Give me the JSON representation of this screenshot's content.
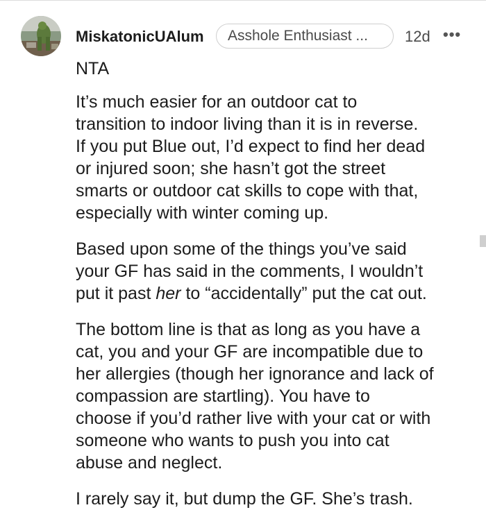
{
  "comment": {
    "username": "MiskatonicUAlum",
    "flair": "Asshole Enthusiast ...",
    "age": "12d",
    "more_label": "•••",
    "paragraphs": [
      {
        "lines": [
          "NTA"
        ]
      },
      {
        "lines": [
          "It’s much easier for an outdoor cat to",
          "transition to indoor living than it is in reverse.",
          "If you put Blue out, I’d expect to find her dead",
          "or injured soon; she hasn’t got the street",
          "smarts or outdoor cat skills to cope with that,",
          "especially with winter coming up."
        ]
      },
      {
        "lines": [
          "Based upon some of the things you’ve said",
          "your GF has said in the comments, I wouldn’t"
        ],
        "last_line": {
          "before": "put it past ",
          "emphasis": "her",
          "after": " to “accidentally” put the cat out."
        }
      },
      {
        "lines": [
          "The bottom line is that as long as you have a",
          "cat, you and your GF are incompatible due to",
          "her allergies (though her ignorance and lack of",
          "compassion are startling). You have to",
          "choose if you’d rather live with your cat or with",
          "someone who wants to push you into cat",
          "abuse and neglect."
        ]
      },
      {
        "lines": [
          "I rarely say it, but dump the GF. She’s trash."
        ]
      }
    ]
  },
  "icons": {
    "avatar": "avatar-image",
    "more": "more-options-icon"
  },
  "colors": {
    "text": "#1c1c1c",
    "secondary_text": "#4a4a4a",
    "flair_border": "#cfcfcf"
  }
}
